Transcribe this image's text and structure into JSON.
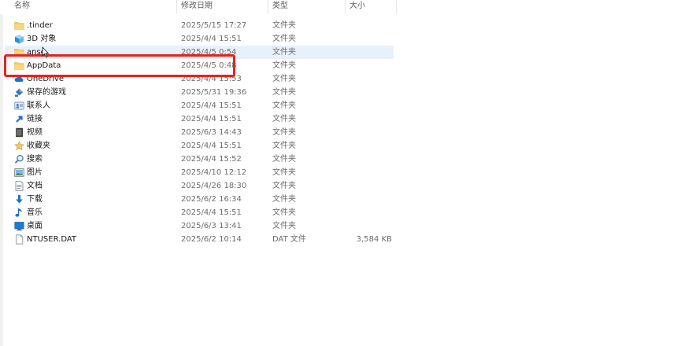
{
  "columns": {
    "name": "名称",
    "date": "修改日期",
    "type": "类型",
    "size": "大小"
  },
  "files": [
    {
      "name": ".tinder",
      "date": "2025/5/15 17:27",
      "type": "文件夹",
      "size": "",
      "icon": "folder-icon"
    },
    {
      "name": "3D 对象",
      "date": "2025/4/4 15:51",
      "type": "文件夹",
      "size": "",
      "icon": "3d-objects-icon"
    },
    {
      "name": "ansc",
      "date": "2025/4/5 0:54",
      "type": "文件夹",
      "size": "",
      "icon": "folder-icon"
    },
    {
      "name": "AppData",
      "date": "2025/4/5 0:48",
      "type": "文件夹",
      "size": "",
      "icon": "folder-icon"
    },
    {
      "name": "OneDrive",
      "date": "2025/4/4 15:53",
      "type": "文件夹",
      "size": "",
      "icon": "onedrive-icon"
    },
    {
      "name": "保存的游戏",
      "date": "2025/5/31 19:36",
      "type": "文件夹",
      "size": "",
      "icon": "saved-games-icon"
    },
    {
      "name": "联系人",
      "date": "2025/4/4 15:51",
      "type": "文件夹",
      "size": "",
      "icon": "contacts-icon"
    },
    {
      "name": "链接",
      "date": "2025/4/4 15:51",
      "type": "文件夹",
      "size": "",
      "icon": "links-icon"
    },
    {
      "name": "视频",
      "date": "2025/6/3 14:43",
      "type": "文件夹",
      "size": "",
      "icon": "videos-icon"
    },
    {
      "name": "收藏夹",
      "date": "2025/4/4 15:51",
      "type": "文件夹",
      "size": "",
      "icon": "favorites-icon"
    },
    {
      "name": "搜索",
      "date": "2025/4/4 15:52",
      "type": "文件夹",
      "size": "",
      "icon": "search-icon"
    },
    {
      "name": "图片",
      "date": "2025/4/10 12:12",
      "type": "文件夹",
      "size": "",
      "icon": "pictures-icon"
    },
    {
      "name": "文档",
      "date": "2025/4/26 18:30",
      "type": "文件夹",
      "size": "",
      "icon": "documents-icon"
    },
    {
      "name": "下载",
      "date": "2025/6/2 16:34",
      "type": "文件夹",
      "size": "",
      "icon": "downloads-icon"
    },
    {
      "name": "音乐",
      "date": "2025/4/4 15:51",
      "type": "文件夹",
      "size": "",
      "icon": "music-icon"
    },
    {
      "name": "桌面",
      "date": "2025/6/3 13:41",
      "type": "文件夹",
      "size": "",
      "icon": "desktop-icon"
    },
    {
      "name": "NTUSER.DAT",
      "date": "2025/6/2 10:14",
      "type": "DAT 文件",
      "size": "3,584 KB",
      "icon": "file-icon"
    }
  ],
  "hovered_row": 2,
  "annotation_highlight_row": 3,
  "colors": {
    "annotation": "#e8231b",
    "hover": "#e8f1fb",
    "folder": "#f6c85f"
  }
}
